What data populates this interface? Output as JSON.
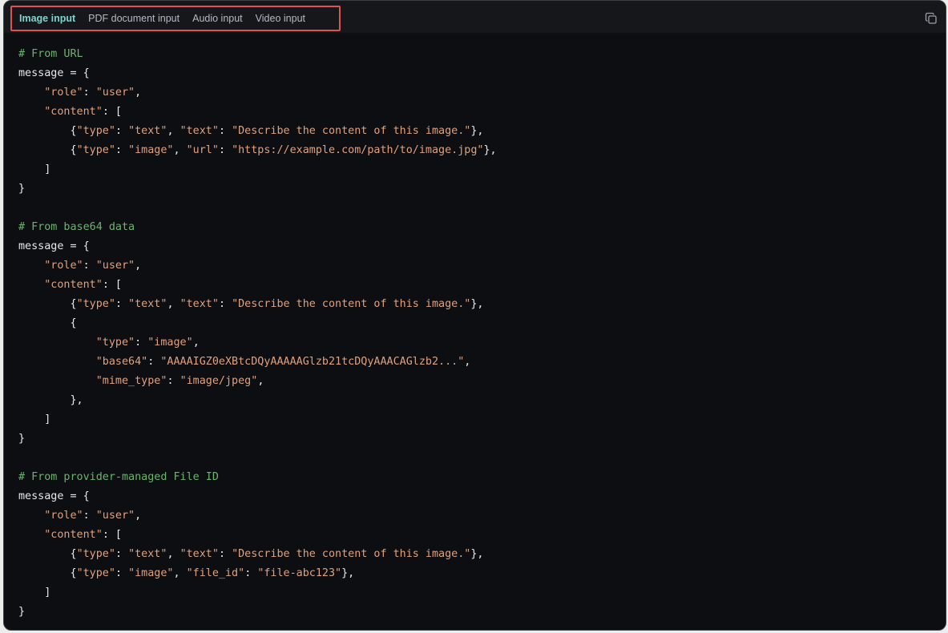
{
  "tabs": [
    {
      "label": "Image input",
      "active": true
    },
    {
      "label": "PDF document input",
      "active": false
    },
    {
      "label": "Audio input",
      "active": false
    },
    {
      "label": "Video input",
      "active": false
    }
  ],
  "icons": {
    "copy": "copy-icon"
  },
  "colors": {
    "background": "#0d0e11",
    "tab_active": "#7fd4cf",
    "comment": "#6ab36f",
    "string": "#e0a27d",
    "highlight_box": "#e05252"
  },
  "code_lines": [
    [
      {
        "t": "c",
        "v": "# From URL"
      }
    ],
    [
      {
        "t": "p",
        "v": "message = {"
      }
    ],
    [
      {
        "t": "p",
        "v": "    "
      },
      {
        "t": "s",
        "v": "\"role\""
      },
      {
        "t": "p",
        "v": ": "
      },
      {
        "t": "s",
        "v": "\"user\""
      },
      {
        "t": "p",
        "v": ","
      }
    ],
    [
      {
        "t": "p",
        "v": "    "
      },
      {
        "t": "s",
        "v": "\"content\""
      },
      {
        "t": "p",
        "v": ": ["
      }
    ],
    [
      {
        "t": "p",
        "v": "        {"
      },
      {
        "t": "s",
        "v": "\"type\""
      },
      {
        "t": "p",
        "v": ": "
      },
      {
        "t": "s",
        "v": "\"text\""
      },
      {
        "t": "p",
        "v": ", "
      },
      {
        "t": "s",
        "v": "\"text\""
      },
      {
        "t": "p",
        "v": ": "
      },
      {
        "t": "s",
        "v": "\"Describe the content of this image.\""
      },
      {
        "t": "p",
        "v": "},"
      }
    ],
    [
      {
        "t": "p",
        "v": "        {"
      },
      {
        "t": "s",
        "v": "\"type\""
      },
      {
        "t": "p",
        "v": ": "
      },
      {
        "t": "s",
        "v": "\"image\""
      },
      {
        "t": "p",
        "v": ", "
      },
      {
        "t": "s",
        "v": "\"url\""
      },
      {
        "t": "p",
        "v": ": "
      },
      {
        "t": "s",
        "v": "\"https://example.com/path/to/image.jpg\""
      },
      {
        "t": "p",
        "v": "},"
      }
    ],
    [
      {
        "t": "p",
        "v": "    ]"
      }
    ],
    [
      {
        "t": "p",
        "v": "}"
      }
    ],
    [],
    [
      {
        "t": "c",
        "v": "# From base64 data"
      }
    ],
    [
      {
        "t": "p",
        "v": "message = {"
      }
    ],
    [
      {
        "t": "p",
        "v": "    "
      },
      {
        "t": "s",
        "v": "\"role\""
      },
      {
        "t": "p",
        "v": ": "
      },
      {
        "t": "s",
        "v": "\"user\""
      },
      {
        "t": "p",
        "v": ","
      }
    ],
    [
      {
        "t": "p",
        "v": "    "
      },
      {
        "t": "s",
        "v": "\"content\""
      },
      {
        "t": "p",
        "v": ": ["
      }
    ],
    [
      {
        "t": "p",
        "v": "        {"
      },
      {
        "t": "s",
        "v": "\"type\""
      },
      {
        "t": "p",
        "v": ": "
      },
      {
        "t": "s",
        "v": "\"text\""
      },
      {
        "t": "p",
        "v": ", "
      },
      {
        "t": "s",
        "v": "\"text\""
      },
      {
        "t": "p",
        "v": ": "
      },
      {
        "t": "s",
        "v": "\"Describe the content of this image.\""
      },
      {
        "t": "p",
        "v": "},"
      }
    ],
    [
      {
        "t": "p",
        "v": "        {"
      }
    ],
    [
      {
        "t": "p",
        "v": "            "
      },
      {
        "t": "s",
        "v": "\"type\""
      },
      {
        "t": "p",
        "v": ": "
      },
      {
        "t": "s",
        "v": "\"image\""
      },
      {
        "t": "p",
        "v": ","
      }
    ],
    [
      {
        "t": "p",
        "v": "            "
      },
      {
        "t": "s",
        "v": "\"base64\""
      },
      {
        "t": "p",
        "v": ": "
      },
      {
        "t": "s",
        "v": "\"AAAAIGZ0eXBtcDQyAAAAAGlzb21tcDQyAAACAGlzb2...\""
      },
      {
        "t": "p",
        "v": ","
      }
    ],
    [
      {
        "t": "p",
        "v": "            "
      },
      {
        "t": "s",
        "v": "\"mime_type\""
      },
      {
        "t": "p",
        "v": ": "
      },
      {
        "t": "s",
        "v": "\"image/jpeg\""
      },
      {
        "t": "p",
        "v": ","
      }
    ],
    [
      {
        "t": "p",
        "v": "        },"
      }
    ],
    [
      {
        "t": "p",
        "v": "    ]"
      }
    ],
    [
      {
        "t": "p",
        "v": "}"
      }
    ],
    [],
    [
      {
        "t": "c",
        "v": "# From provider-managed File ID"
      }
    ],
    [
      {
        "t": "p",
        "v": "message = {"
      }
    ],
    [
      {
        "t": "p",
        "v": "    "
      },
      {
        "t": "s",
        "v": "\"role\""
      },
      {
        "t": "p",
        "v": ": "
      },
      {
        "t": "s",
        "v": "\"user\""
      },
      {
        "t": "p",
        "v": ","
      }
    ],
    [
      {
        "t": "p",
        "v": "    "
      },
      {
        "t": "s",
        "v": "\"content\""
      },
      {
        "t": "p",
        "v": ": ["
      }
    ],
    [
      {
        "t": "p",
        "v": "        {"
      },
      {
        "t": "s",
        "v": "\"type\""
      },
      {
        "t": "p",
        "v": ": "
      },
      {
        "t": "s",
        "v": "\"text\""
      },
      {
        "t": "p",
        "v": ", "
      },
      {
        "t": "s",
        "v": "\"text\""
      },
      {
        "t": "p",
        "v": ": "
      },
      {
        "t": "s",
        "v": "\"Describe the content of this image.\""
      },
      {
        "t": "p",
        "v": "},"
      }
    ],
    [
      {
        "t": "p",
        "v": "        {"
      },
      {
        "t": "s",
        "v": "\"type\""
      },
      {
        "t": "p",
        "v": ": "
      },
      {
        "t": "s",
        "v": "\"image\""
      },
      {
        "t": "p",
        "v": ", "
      },
      {
        "t": "s",
        "v": "\"file_id\""
      },
      {
        "t": "p",
        "v": ": "
      },
      {
        "t": "s",
        "v": "\"file-abc123\""
      },
      {
        "t": "p",
        "v": "},"
      }
    ],
    [
      {
        "t": "p",
        "v": "    ]"
      }
    ],
    [
      {
        "t": "p",
        "v": "}"
      }
    ]
  ]
}
